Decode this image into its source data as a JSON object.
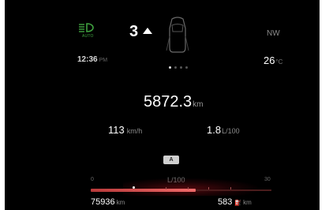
{
  "status_bar": {
    "headlight_icon": "auto-headlight-icon",
    "auto_label": "AUTO",
    "gear": "3",
    "gear_arrow_icon": "shift-up-arrow-icon",
    "car_icon": "car-top-view-icon",
    "compass": "NW",
    "accent_color": "#3fa13f"
  },
  "info_row": {
    "time": "12:36",
    "ampm": "PM",
    "page_count": 4,
    "active_page": 1,
    "temperature": "26",
    "temperature_unit": "°C"
  },
  "trip": {
    "distance": "5872.3",
    "distance_unit": "km",
    "avg_speed": "113",
    "avg_speed_unit": "km/h",
    "avg_consumption": "1.8",
    "avg_consumption_unit": "L/100"
  },
  "mode_badge": {
    "label": "A"
  },
  "consumption_bar": {
    "min_label": "0",
    "unit_label": "L/100",
    "max_label": "30",
    "fill_fraction": 0.58,
    "bar_color": "#e04848"
  },
  "bottom": {
    "total_odometer": "75936",
    "total_odometer_unit": "km",
    "range": "583",
    "range_unit": "km",
    "fuel_icon": "fuel-pump-icon"
  }
}
